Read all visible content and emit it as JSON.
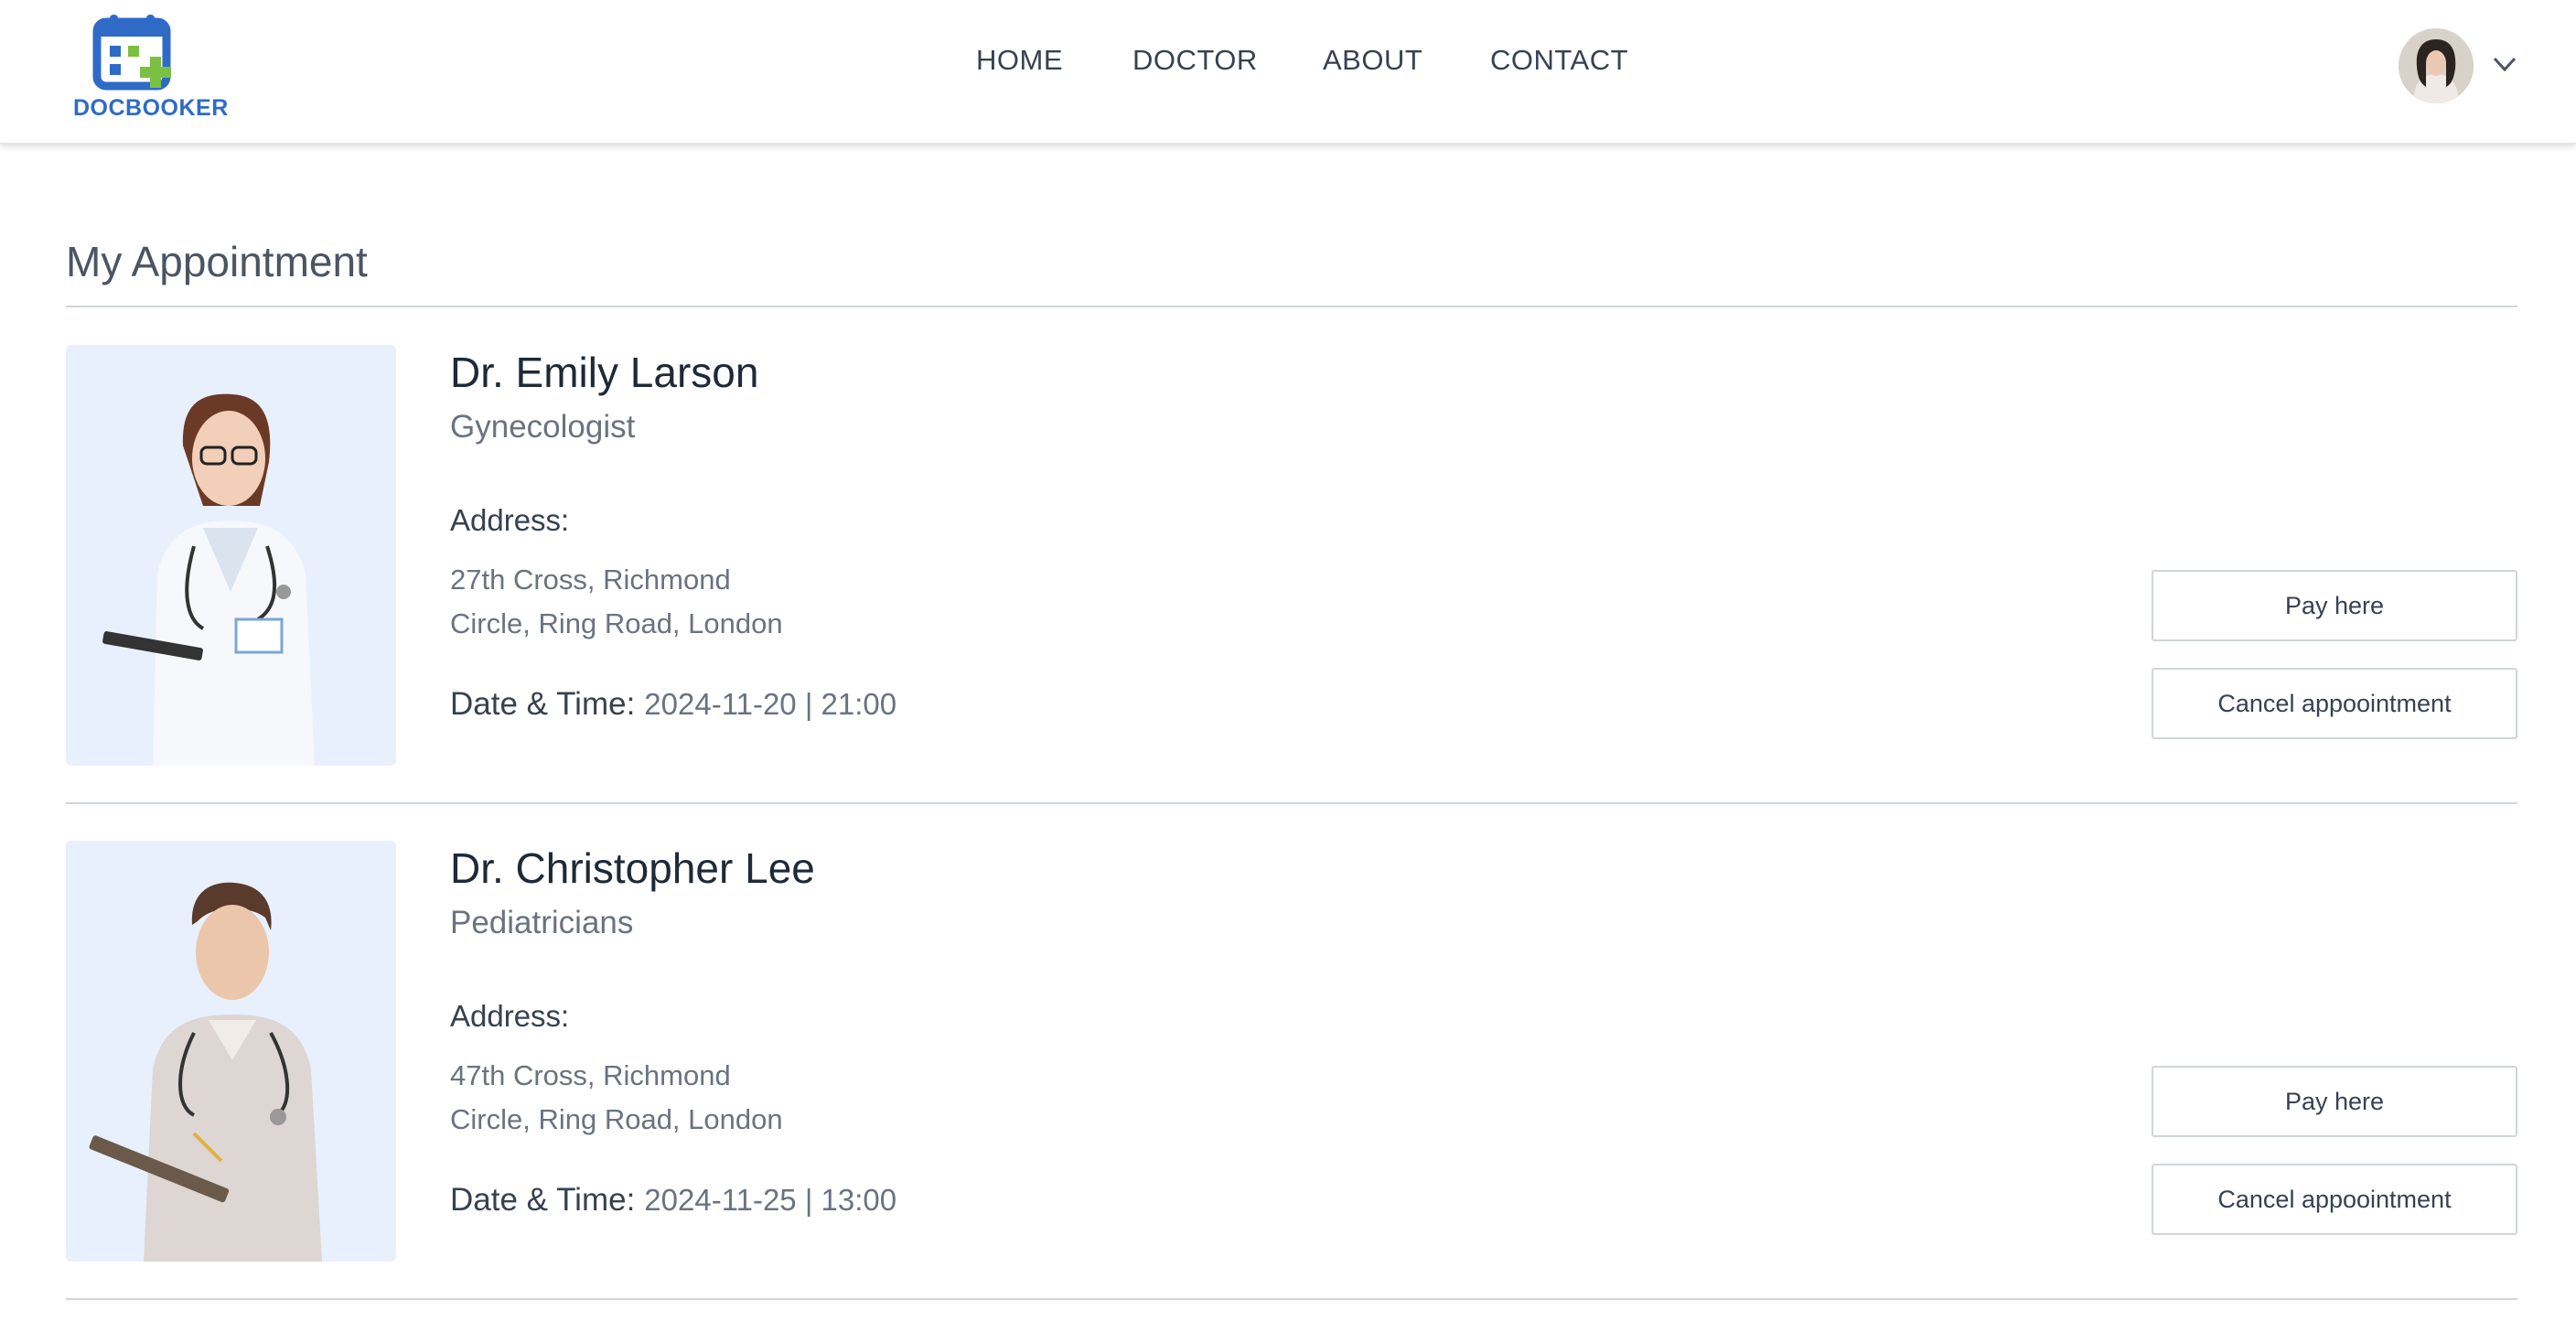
{
  "brand": {
    "name": "DOCBOOKER",
    "colors": {
      "primary": "#2f6bc6",
      "accent": "#7ac143"
    }
  },
  "nav": {
    "items": [
      {
        "label": "HOME"
      },
      {
        "label": "DOCTOR"
      },
      {
        "label": "ABOUT"
      },
      {
        "label": "CONTACT"
      }
    ]
  },
  "user_menu": {
    "icon": "chevron-down-icon"
  },
  "page": {
    "title": "My Appointment"
  },
  "appointments": [
    {
      "doctor_name": "Dr. Emily Larson",
      "specialty": "Gynecologist",
      "address_label": "Address:",
      "address_line1": "27th Cross, Richmond",
      "address_line2": "Circle, Ring Road, London",
      "datetime_label": "Date & Time:",
      "datetime_value": "2024-11-20 | 21:00",
      "pay_label": "Pay here",
      "cancel_label": "Cancel appoointment"
    },
    {
      "doctor_name": "Dr. Christopher Lee",
      "specialty": "Pediatricians",
      "address_label": "Address:",
      "address_line1": "47th Cross, Richmond",
      "address_line2": "Circle, Ring Road, London",
      "datetime_label": "Date & Time:",
      "datetime_value": "2024-11-25 | 13:00",
      "pay_label": "Pay here",
      "cancel_label": "Cancel appoointment"
    }
  ]
}
